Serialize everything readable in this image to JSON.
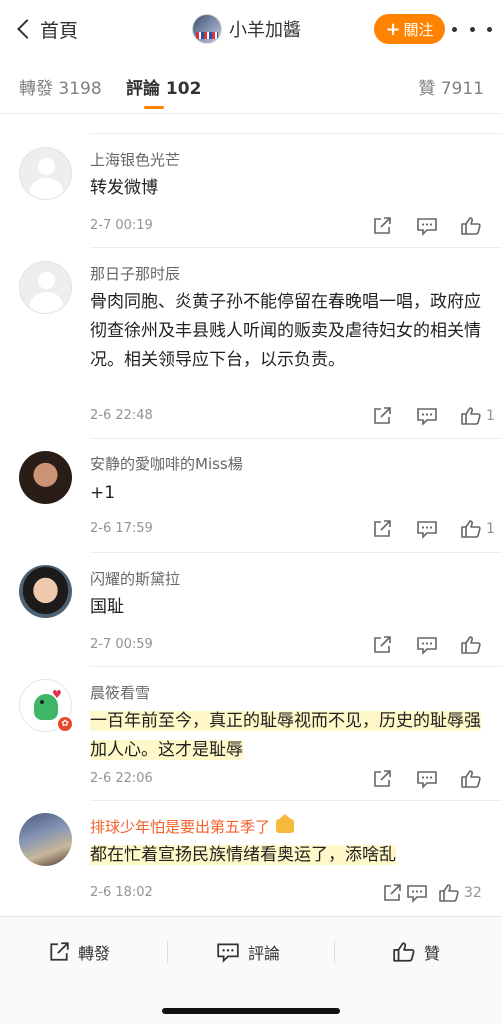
{
  "header": {
    "back_label": "首頁",
    "profile_name": "小羊加醬",
    "follow_label": "關注",
    "follow_plus": "+"
  },
  "tabs": {
    "reposts": "轉發 3198",
    "comments": "評論 102",
    "likes": "贊 7911"
  },
  "comments": [
    {
      "name": "上海银色光芒",
      "text": "转发微博",
      "time": "2-7 00:19",
      "likes": ""
    },
    {
      "name": "那日子那时辰",
      "text": "骨肉同胞、炎黄子孙不能停留在春晚唱一唱，政府应彻查徐州及丰县贱人听闻的贩卖及虐待妇女的相关情况。相关领导应下台，以示负责。",
      "time": "2-6 22:48",
      "likes": "1"
    },
    {
      "name": "安静的愛咖啡的Miss楊",
      "text": "+1",
      "time": "2-6 17:59",
      "likes": "1"
    },
    {
      "name": "闪耀的斯黛拉",
      "text": "国耻",
      "time": "2-7 00:59",
      "likes": ""
    },
    {
      "name": "晨筱看雪",
      "text": "一百年前至今，真正的耻辱视而不见，历史的耻辱强加人心。这才是耻辱",
      "time": "2-6 22:06",
      "likes": ""
    },
    {
      "name": "排球少年怕是要出第五季了",
      "text": "都在忙着宣扬民族情绪看奥运了，添啥乱",
      "time": "2-6 18:02",
      "likes": "32"
    }
  ],
  "bottom_bar": {
    "repost": "轉發",
    "comment": "評論",
    "like": "贊"
  },
  "colors": {
    "accent": "#ff8200",
    "highlight": "#fff8c9",
    "vip_name": "#f5612a"
  },
  "icons": [
    "chevron-left-icon",
    "more-dots-icon",
    "share-icon",
    "reply-icon",
    "like-icon",
    "crown-icon"
  ]
}
